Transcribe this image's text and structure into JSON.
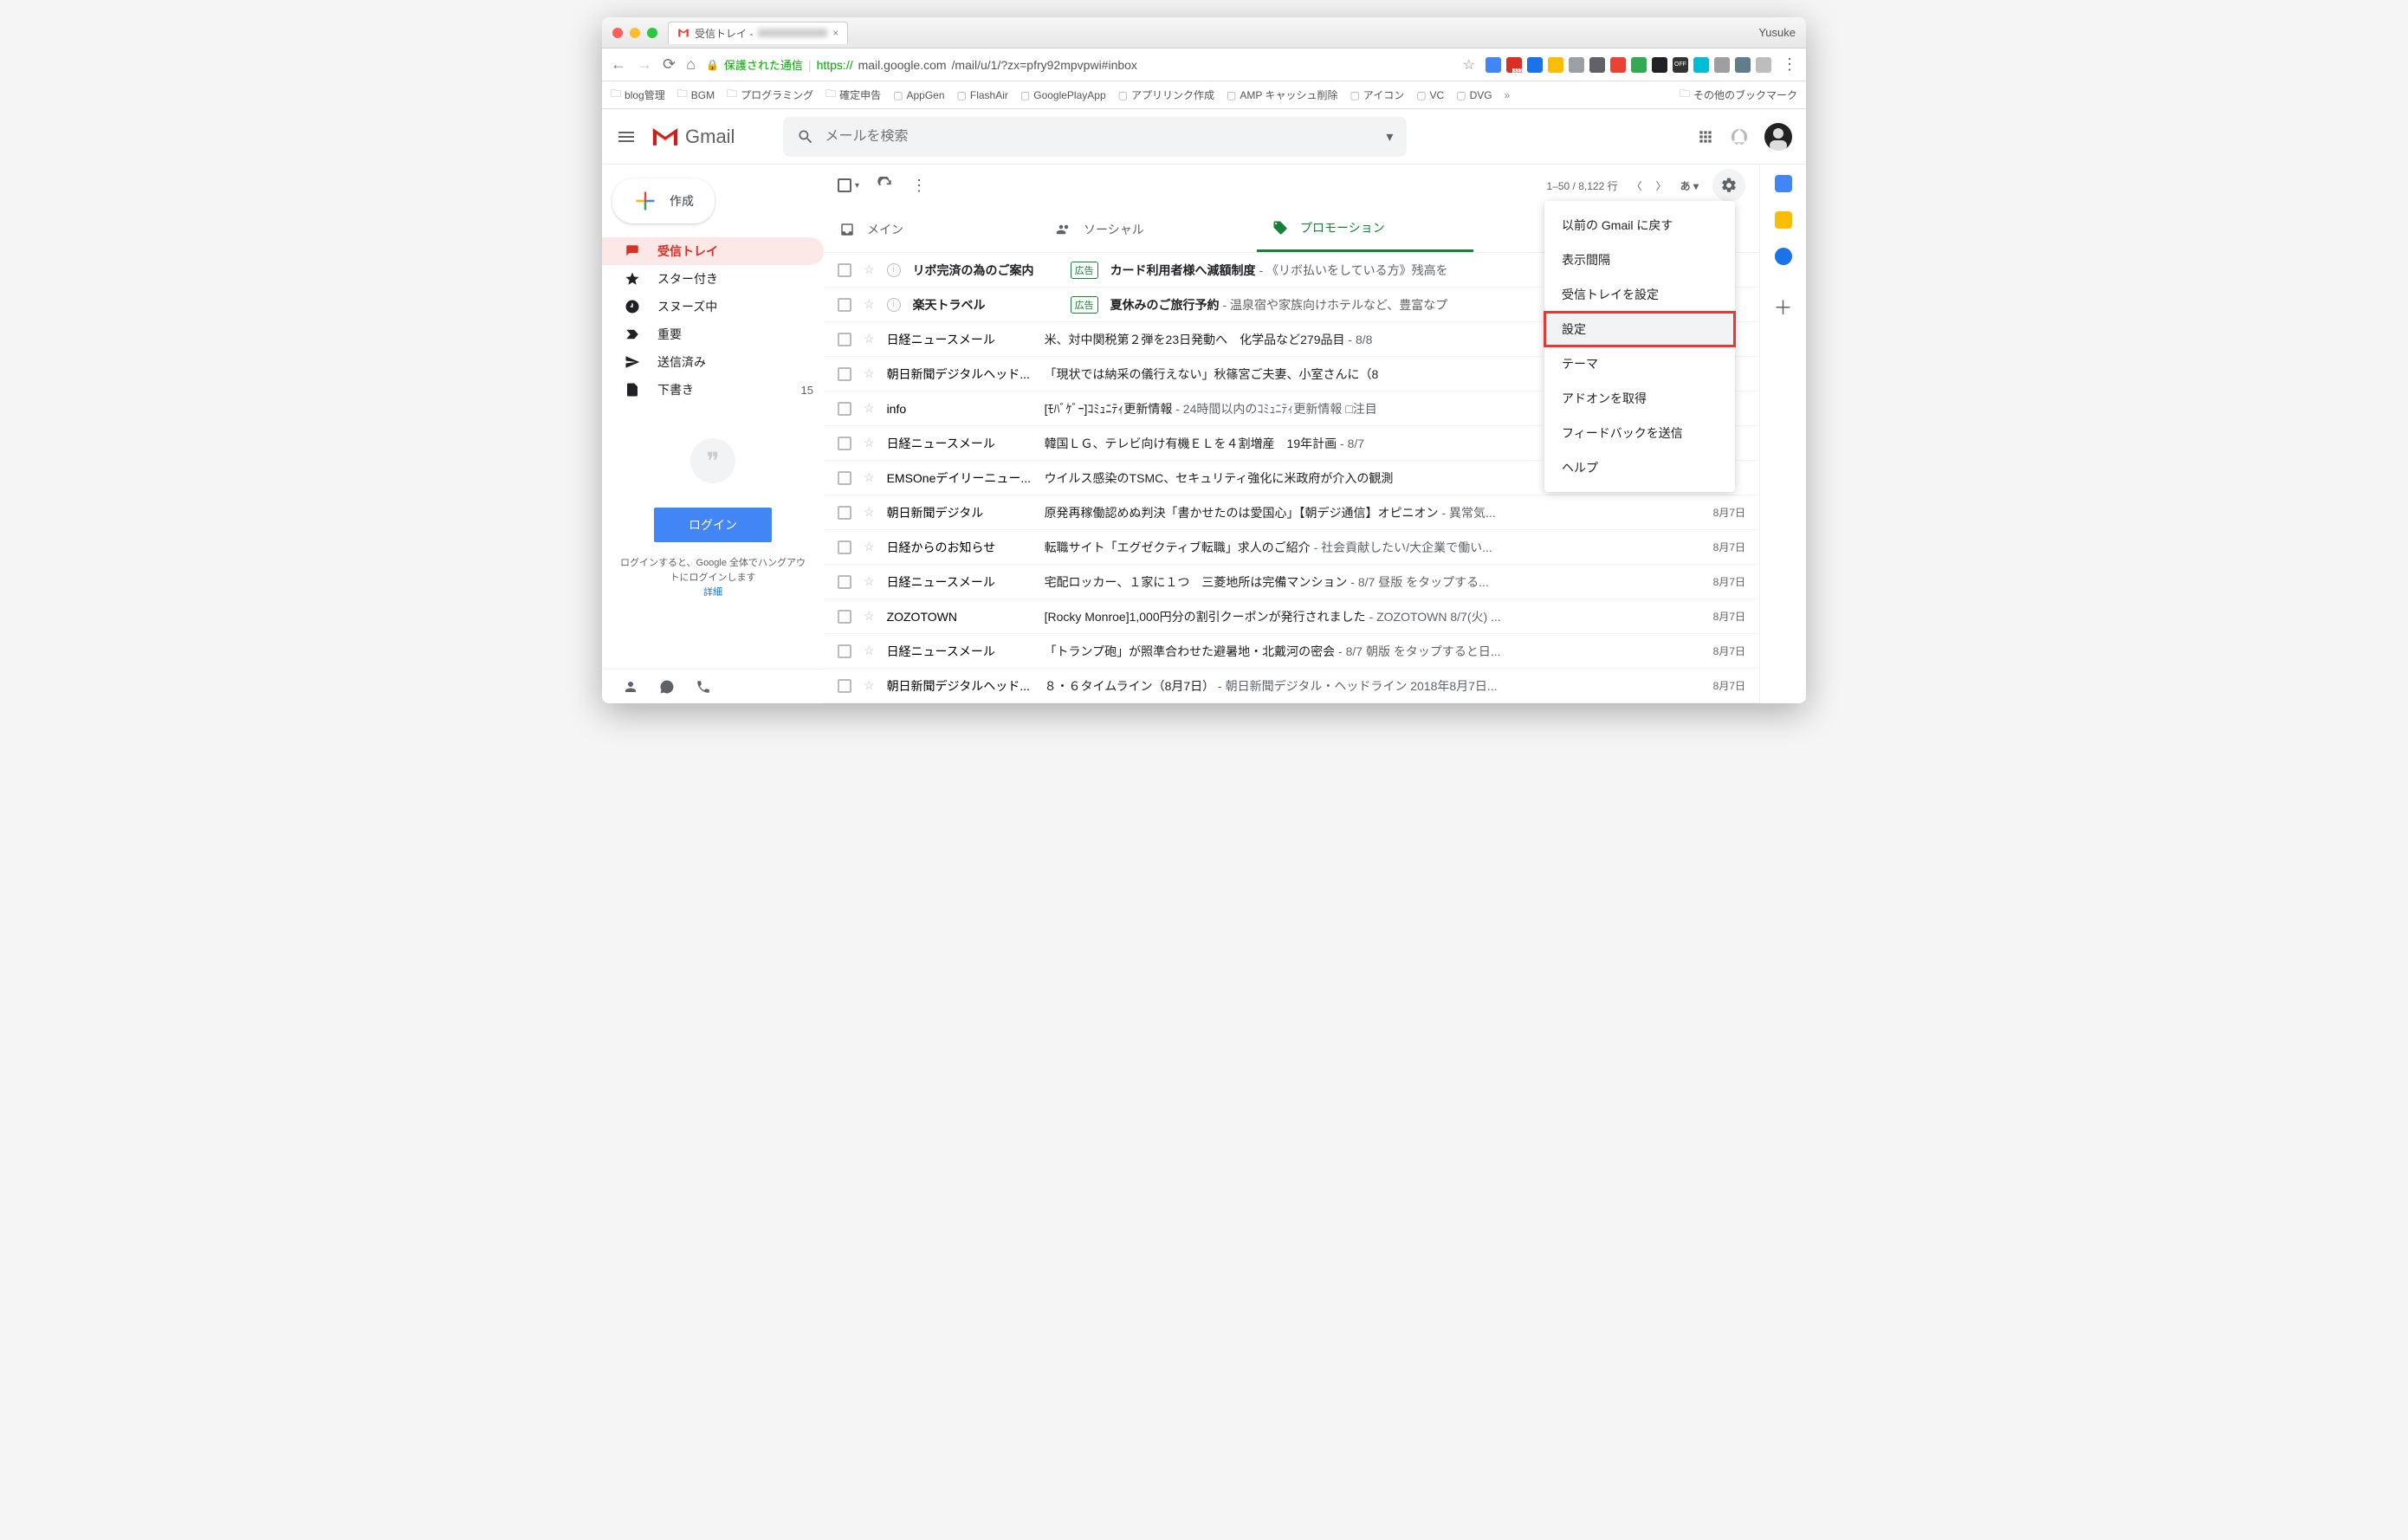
{
  "window": {
    "profile": "Yusuke",
    "tab_title_prefix": "受信トレイ - "
  },
  "url": {
    "secure_label": "保護された通信",
    "https": "https://",
    "host": "mail.google.com",
    "path": "/mail/u/1/?zx=pfry92mpvpwi#inbox"
  },
  "bookmarks": [
    "blog管理",
    "BGM",
    "プログラミング",
    "確定申告",
    "AppGen",
    "FlashAir",
    "GooglePlayApp",
    "アプリリンク作成",
    "AMP キャッシュ削除",
    "アイコン",
    "VC",
    "DVG"
  ],
  "bookmarks_other": "その他のブックマーク",
  "gmail": {
    "brand": "Gmail",
    "search_placeholder": "メールを検索",
    "compose": "作成"
  },
  "nav": [
    {
      "label": "受信トレイ",
      "icon": "inbox",
      "active": true
    },
    {
      "label": "スター付き",
      "icon": "star"
    },
    {
      "label": "スヌーズ中",
      "icon": "clock"
    },
    {
      "label": "重要",
      "icon": "important"
    },
    {
      "label": "送信済み",
      "icon": "send"
    },
    {
      "label": "下書き",
      "icon": "draft",
      "count": "15"
    }
  ],
  "hangouts": {
    "login": "ログイン",
    "text": "ログインすると、Google 全体でハングアウトにログインします",
    "detail": "詳細"
  },
  "toolbar": {
    "range": "1–50 / 8,122 行",
    "ime": "あ"
  },
  "tabs": [
    {
      "label": "メイン",
      "icon": "inbox"
    },
    {
      "label": "ソーシャル",
      "icon": "people"
    },
    {
      "label": "プロモーション",
      "icon": "tag",
      "active": true
    }
  ],
  "ad_label": "広告",
  "messages": [
    {
      "unread": true,
      "ad": true,
      "sender": "リボ完済の為のご案内",
      "subject": "カード利用者様へ減額制度",
      "preview": " - 《リボ払いをしている方》残高を",
      "date": ""
    },
    {
      "unread": true,
      "ad": true,
      "sender": "楽天トラベル",
      "subject": "夏休みのご旅行予約",
      "preview": " - 温泉宿や家族向けホテルなど、豊富なプ",
      "date": ""
    },
    {
      "sender": "日経ニュースメール",
      "subject": "米、対中関税第２弾を23日発動へ　化学品など279品目",
      "preview": " - 8/8",
      "date": ""
    },
    {
      "sender": "朝日新聞デジタルヘッド...",
      "subject": "「現状では納采の儀行えない」秋篠宮ご夫妻、小室さんに（8",
      "preview": "",
      "date": ""
    },
    {
      "sender": "info",
      "subject": "[ﾓﾊﾞｹﾞｰ]ｺﾐｭﾆﾃｨ更新情報",
      "preview": " - 24時間以内のｺﾐｭﾆﾃｨ更新情報 □注目",
      "date": ""
    },
    {
      "sender": "日経ニュースメール",
      "subject": "韓国ＬＧ、テレビ向け有機ＥＬを４割増産　19年計画",
      "preview": " - 8/7",
      "date": ""
    },
    {
      "sender": "EMSOneデイリーニュー...",
      "subject": "ウイルス感染のTSMC、セキュリティ強化に米政府が介入の観測",
      "preview": "",
      "date": ""
    },
    {
      "sender": "朝日新聞デジタル",
      "subject": "原発再稼働認めぬ判決「書かせたのは愛国心」【朝デジ通信】オピニオン",
      "preview": " - 異常気...",
      "date": "8月7日"
    },
    {
      "sender": "日経からのお知らせ",
      "subject": "転職サイト「エグゼクティブ転職」求人のご紹介",
      "preview": " - 社会貢献したい/大企業で働い...",
      "date": "8月7日"
    },
    {
      "sender": "日経ニュースメール",
      "subject": "宅配ロッカー、１家に１つ　三菱地所は完備マンション",
      "preview": " - 8/7 昼版 をタップする...",
      "date": "8月7日"
    },
    {
      "sender": "ZOZOTOWN",
      "subject": "[Rocky Monroe]1,000円分の割引クーポンが発行されました",
      "preview": " - ZOZOTOWN 8/7(火) ...",
      "date": "8月7日"
    },
    {
      "sender": "日経ニュースメール",
      "subject": "「トランプ砲」が照準合わせた避暑地・北戴河の密会",
      "preview": " - 8/7 朝版 をタップすると日...",
      "date": "8月7日"
    },
    {
      "sender": "朝日新聞デジタルヘッド...",
      "subject": "８・６タイムライン（8月7日）",
      "preview": " - 朝日新聞デジタル・ヘッドライン 2018年8月7日...",
      "date": "8月7日"
    }
  ],
  "settings_menu": [
    "以前の Gmail に戻す",
    "表示間隔",
    "受信トレイを設定",
    "設定",
    "テーマ",
    "アドオンを取得",
    "フィードバックを送信",
    "ヘルプ"
  ],
  "settings_highlight_index": 3
}
